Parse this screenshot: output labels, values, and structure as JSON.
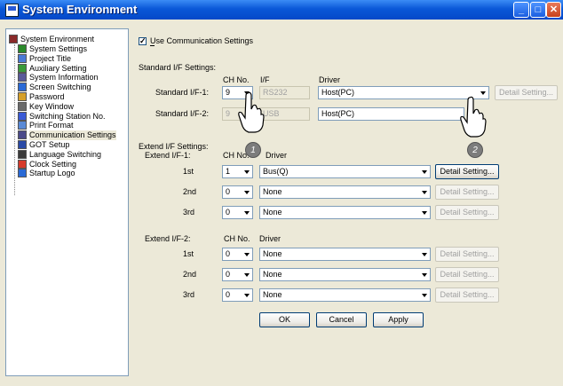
{
  "window": {
    "title": "System Environment"
  },
  "tree": {
    "root": "System Environment",
    "items": [
      {
        "label": "System Settings",
        "icon": "settings-icon",
        "color": "#2a8a2a"
      },
      {
        "label": "Project Title",
        "icon": "title-icon",
        "color": "#4a7ad6"
      },
      {
        "label": "Auxiliary Setting",
        "icon": "auxiliary-icon",
        "color": "#3a9a3a"
      },
      {
        "label": "System Information",
        "icon": "info-icon",
        "color": "#5a5a9a"
      },
      {
        "label": "Screen Switching",
        "icon": "screen-icon",
        "color": "#2a6ad6"
      },
      {
        "label": "Password",
        "icon": "password-icon",
        "color": "#d6a02a"
      },
      {
        "label": "Key Window",
        "icon": "key-window-icon",
        "color": "#6a6a6a"
      },
      {
        "label": "Switching Station No.",
        "icon": "station-icon",
        "color": "#3a5ad6"
      },
      {
        "label": "Print Format",
        "icon": "print-icon",
        "color": "#5a8ad6"
      },
      {
        "label": "Communication Settings",
        "icon": "communication-icon",
        "color": "#4a4a8a"
      },
      {
        "label": "GOT Setup",
        "icon": "got-icon",
        "color": "#2a4aa6"
      },
      {
        "label": "Language Switching",
        "icon": "language-icon",
        "color": "#3a3a3a"
      },
      {
        "label": "Clock Setting",
        "icon": "clock-icon",
        "color": "#d63a2a"
      },
      {
        "label": "Startup Logo",
        "icon": "logo-icon",
        "color": "#2a6ad6"
      }
    ]
  },
  "use_comm": {
    "label": "Use Communication Settings",
    "checked": true
  },
  "standard": {
    "section_label": "Standard I/F Settings:",
    "col_ch": "CH No.",
    "col_if": "I/F",
    "col_driver": "Driver",
    "row1": {
      "label": "Standard I/F-1:",
      "ch": "9",
      "if": "RS232",
      "driver": "Host(PC)",
      "detail": "Detail Setting..."
    },
    "row2": {
      "label": "Standard I/F-2:",
      "ch": "9",
      "if": "USB",
      "driver": "Host(PC)"
    }
  },
  "extend1": {
    "section_label": "Extend I/F Settings:",
    "label": "Extend I/F-1:",
    "col_ch": "CH No.",
    "col_driver": "Driver",
    "rows": [
      {
        "label": "1st",
        "ch": "1",
        "driver": "Bus(Q)",
        "detail": "Detail Setting..."
      },
      {
        "label": "2nd",
        "ch": "0",
        "driver": "None",
        "detail": "Detail Setting..."
      },
      {
        "label": "3rd",
        "ch": "0",
        "driver": "None",
        "detail": "Detail Setting..."
      }
    ]
  },
  "extend2": {
    "label": "Extend I/F-2:",
    "col_ch": "CH No.",
    "col_driver": "Driver",
    "rows": [
      {
        "label": "1st",
        "ch": "0",
        "driver": "None",
        "detail": "Detail Setting..."
      },
      {
        "label": "2nd",
        "ch": "0",
        "driver": "None",
        "detail": "Detail Setting..."
      },
      {
        "label": "3rd",
        "ch": "0",
        "driver": "None",
        "detail": "Detail Setting..."
      }
    ]
  },
  "buttons": {
    "ok": "OK",
    "cancel": "Cancel",
    "apply": "Apply"
  },
  "callouts": {
    "one": "1",
    "two": "2"
  }
}
